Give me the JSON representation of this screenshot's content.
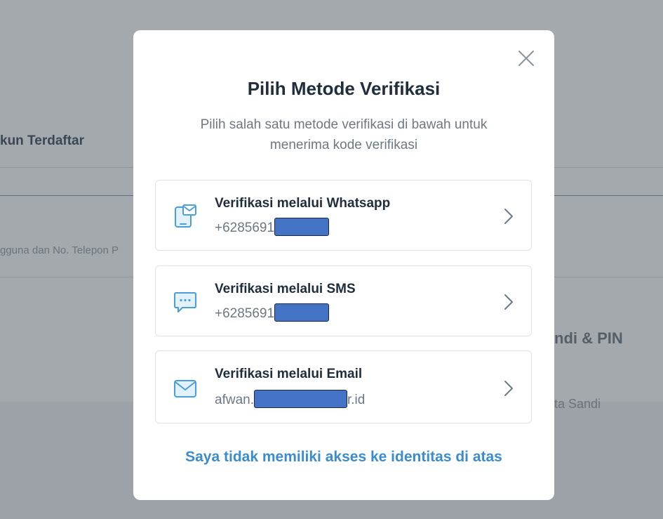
{
  "background": {
    "heading_left": "kun Terdaftar",
    "small_left": "gguna dan No. Telepon P",
    "heading_right": "ndi & PIN",
    "small_right": "ta Sandi"
  },
  "modal": {
    "title": "Pilih Metode Verifikasi",
    "subtitle": "Pilih salah satu metode verifikasi di bawah untuk menerima kode verifikasi",
    "options": [
      {
        "title": "Verifikasi melalui Whatsapp",
        "value_prefix": "+6285691",
        "value_suffix": "",
        "icon": "whatsapp-message-icon"
      },
      {
        "title": "Verifikasi melalui SMS",
        "value_prefix": "+6285691",
        "value_suffix": "",
        "icon": "sms-chat-icon"
      },
      {
        "title": "Verifikasi melalui Email",
        "value_prefix": "afwan.",
        "value_suffix": "r.id",
        "icon": "email-envelope-icon"
      }
    ],
    "no_access_link": "Saya tidak memiliki akses ke identitas di atas"
  },
  "colors": {
    "accent_icon": "#4a9fd8",
    "link": "#3c8ccd",
    "redaction": "#4472c4"
  }
}
